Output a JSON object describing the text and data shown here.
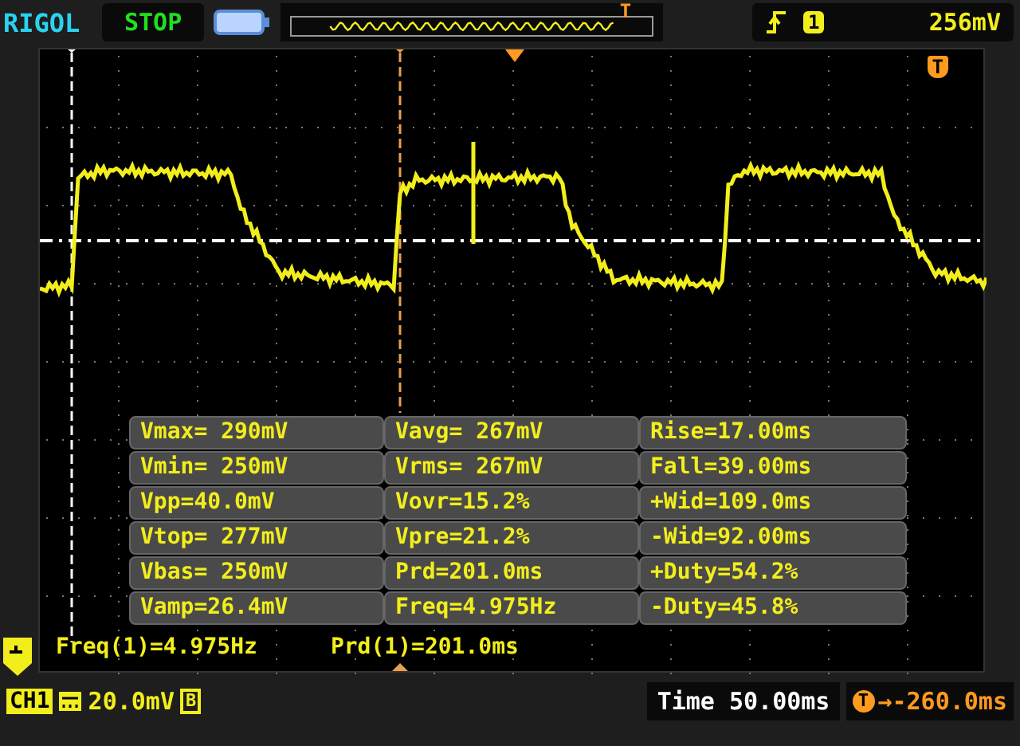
{
  "header": {
    "brand": "RIGOL",
    "run_state": "STOP",
    "trigger_marker": "T",
    "trigger_channel": "1",
    "trigger_level": "256mV"
  },
  "screen": {
    "trigger_marker": "T"
  },
  "measurements": [
    {
      "cells": [
        "Vmax= 290mV",
        "Vavg= 267mV",
        "Rise=17.00ms"
      ]
    },
    {
      "cells": [
        "Vmin= 250mV",
        "Vrms= 267mV",
        "Fall=39.00ms"
      ]
    },
    {
      "cells": [
        "Vpp=40.0mV",
        "Vovr=15.2%",
        "+Wid=109.0ms"
      ]
    },
    {
      "cells": [
        "Vtop= 277mV",
        "Vpre=21.2%",
        "-Wid=92.00ms"
      ]
    },
    {
      "cells": [
        "Vbas= 250mV",
        "Prd=201.0ms",
        "+Duty=54.2%"
      ]
    },
    {
      "cells": [
        "Vamp=26.4mV",
        "Freq=4.975Hz",
        "-Duty=45.8%"
      ]
    }
  ],
  "statistics": [
    "Freq(1)=4.975Hz",
    "Prd(1)=201.0ms"
  ],
  "footer": {
    "channel": "CH1",
    "scale": "20.0mV",
    "bandwidth": "B",
    "timebase": "Time 50.00ms",
    "trigger_marker": "T",
    "trigger_offset": "→-260.0ms"
  }
}
